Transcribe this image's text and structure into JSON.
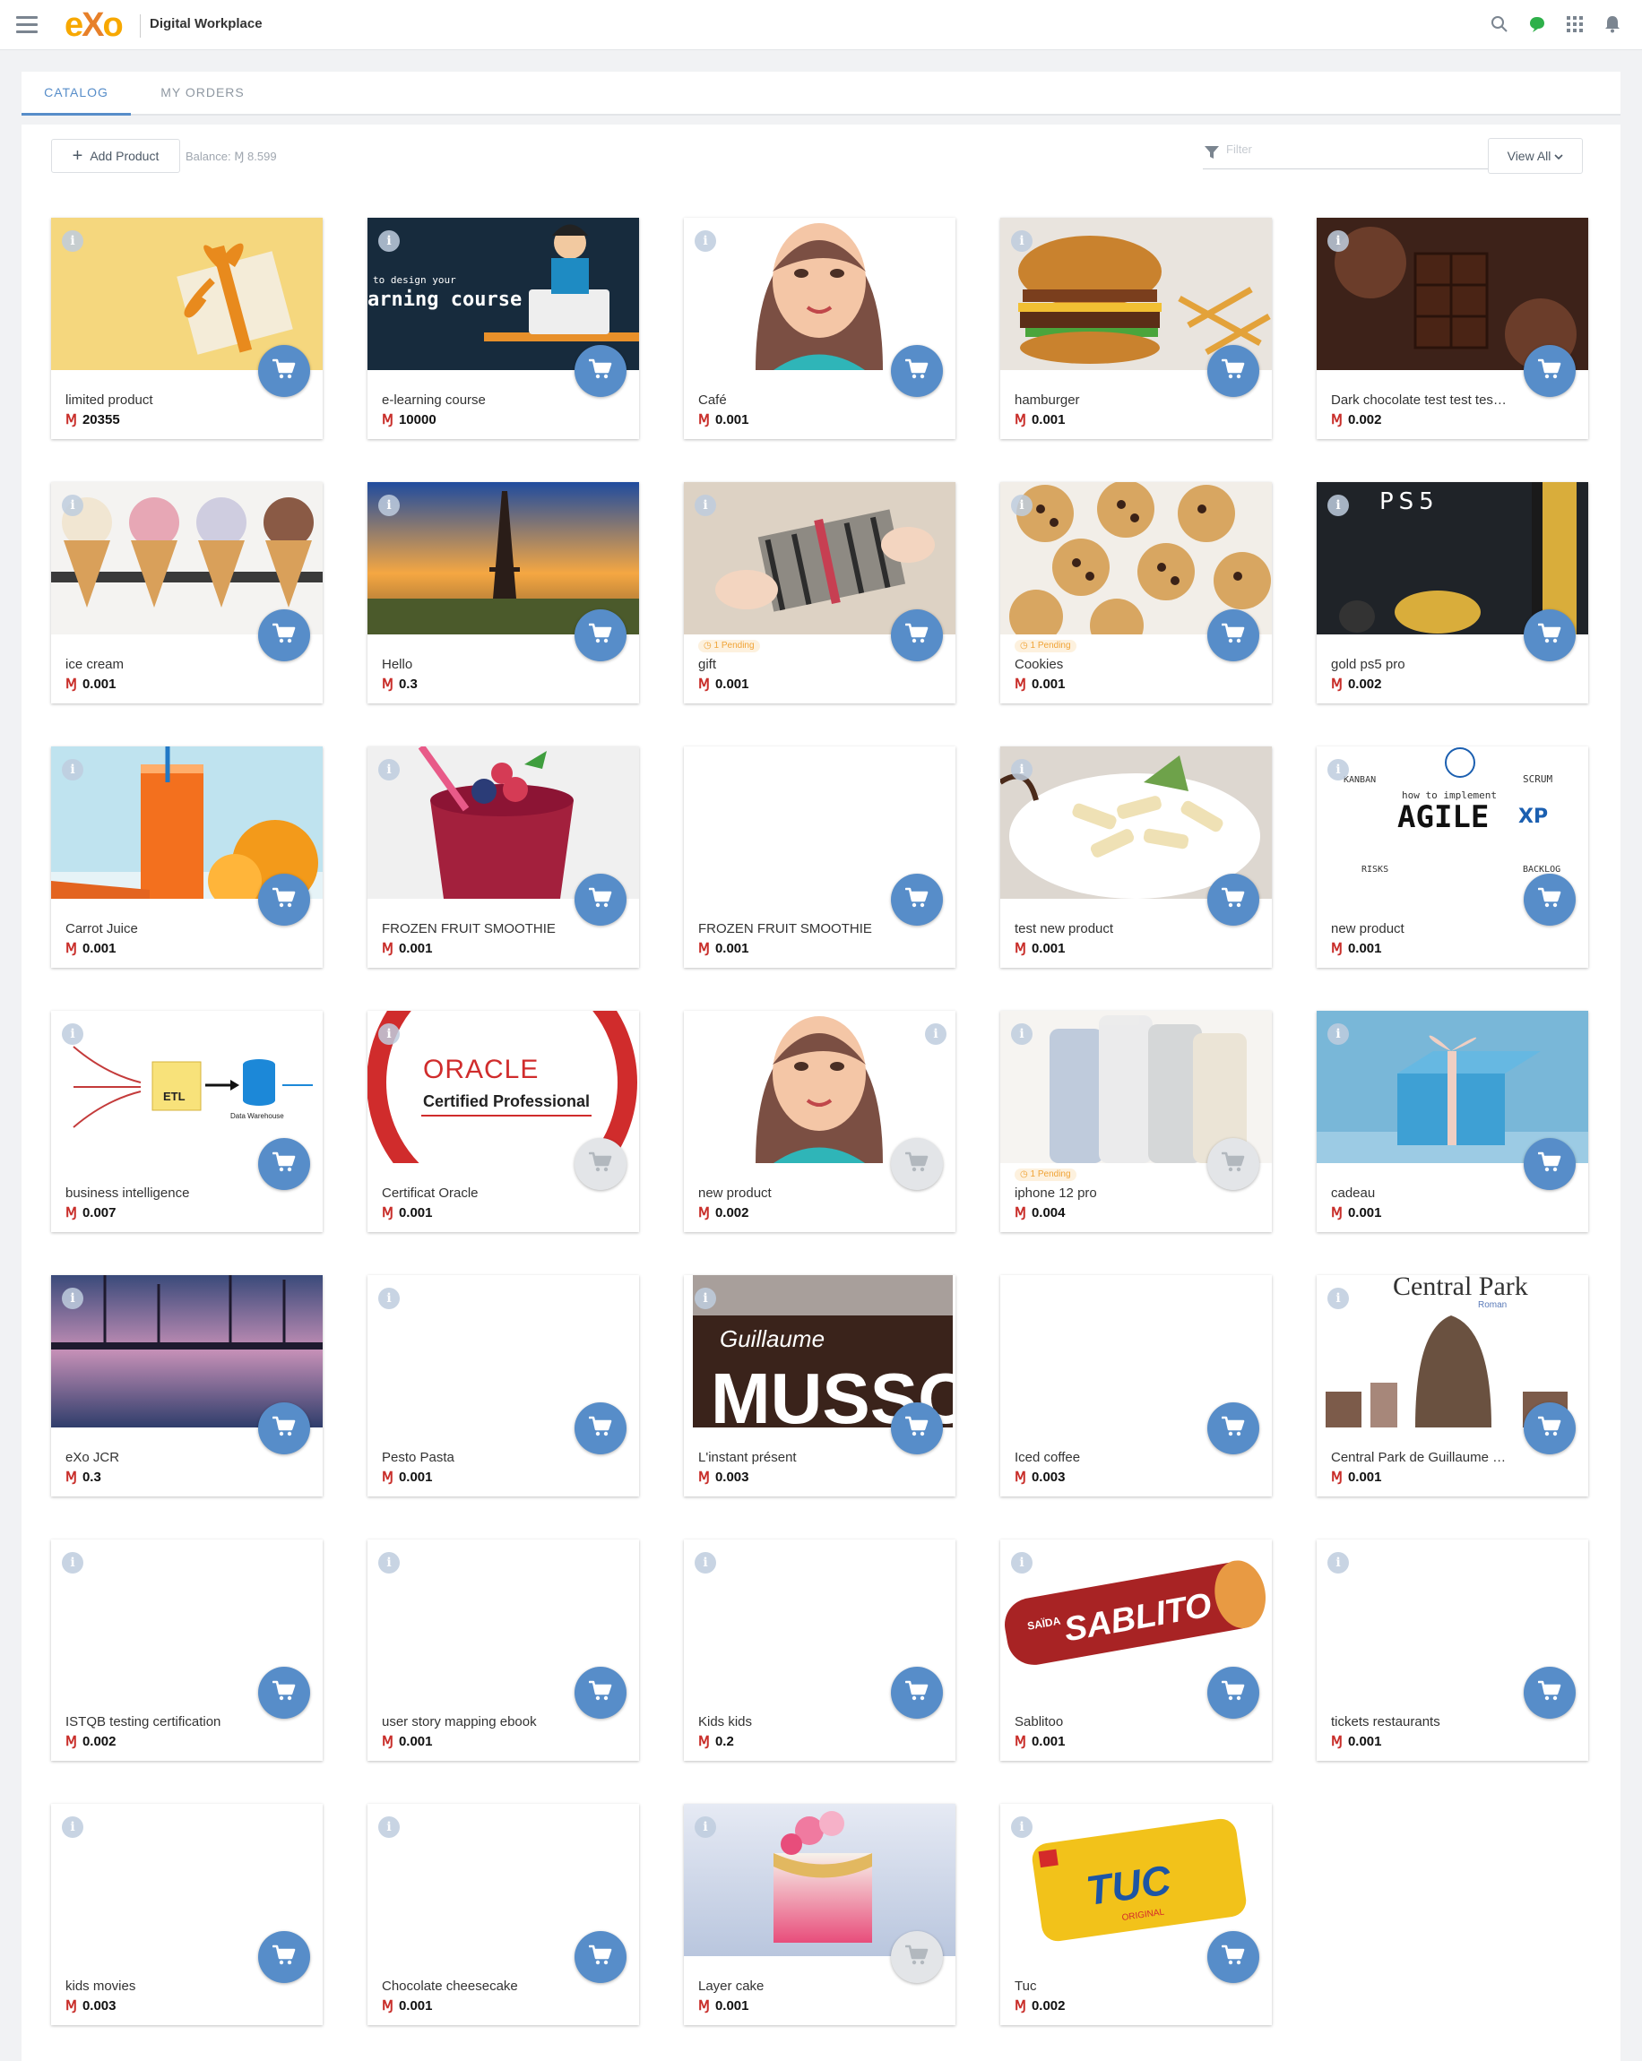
{
  "topbar": {
    "logo": "eXo",
    "title": "Digital Workplace"
  },
  "tabs": [
    {
      "label": "CATALOG"
    },
    {
      "label": "MY ORDERS"
    }
  ],
  "toolbar": {
    "add_label": "Add Product",
    "balance": "Balance: Ɱ 8.599",
    "filter_placeholder": "Filter",
    "view_label": "View All"
  },
  "currency_symbol": "Ɱ",
  "products": [
    {
      "title": "limited product",
      "price": "20355",
      "image": "gift",
      "cart_enabled": true
    },
    {
      "title": "e-learning course",
      "price": "10000",
      "image": "elearning",
      "cart_enabled": true
    },
    {
      "title": "Café",
      "price": "0.001",
      "image": "avatar",
      "cart_enabled": true
    },
    {
      "title": "hamburger",
      "price": "0.001",
      "image": "burger",
      "cart_enabled": true
    },
    {
      "title": "Dark chocolate test test test test",
      "price": "0.002",
      "image": "chocolate",
      "cart_enabled": true
    },
    {
      "title": "ice cream",
      "price": "0.001",
      "image": "icecream",
      "cart_enabled": true
    },
    {
      "title": "Hello",
      "price": "0.3",
      "image": "paris",
      "cart_enabled": true
    },
    {
      "title": "gift",
      "price": "0.001",
      "image": "giftbox",
      "cart_enabled": true,
      "pending": "1 Pending"
    },
    {
      "title": "Cookies",
      "price": "0.001",
      "image": "cookies",
      "cart_enabled": true,
      "pending": "1 Pending"
    },
    {
      "title": "gold ps5 pro",
      "price": "0.002",
      "image": "ps5",
      "cart_enabled": true
    },
    {
      "title": "Carrot Juice",
      "price": "0.001",
      "image": "juice",
      "cart_enabled": true
    },
    {
      "title": "FROZEN FRUIT SMOOTHIE",
      "price": "0.001",
      "image": "smoothie",
      "cart_enabled": true
    },
    {
      "title": "FROZEN FRUIT SMOOTHIE",
      "price": "0.001",
      "image": "blank",
      "cart_enabled": true,
      "no_info": true
    },
    {
      "title": "test new product",
      "price": "0.001",
      "image": "pasta",
      "cart_enabled": true
    },
    {
      "title": "new product",
      "price": "0.001",
      "image": "agile",
      "cart_enabled": true
    },
    {
      "title": "business intelligence",
      "price": "0.007",
      "image": "etl",
      "cart_enabled": true
    },
    {
      "title": "Certificat Oracle",
      "price": "0.001",
      "image": "oracle",
      "cart_enabled": false
    },
    {
      "title": "new product",
      "price": "0.002",
      "image": "avatar",
      "cart_enabled": false,
      "info_right": true
    },
    {
      "title": "iphone 12 pro",
      "price": "0.004",
      "image": "iphone",
      "cart_enabled": false,
      "pending": "1 Pending"
    },
    {
      "title": "cadeau",
      "price": "0.001",
      "image": "bluegift",
      "cart_enabled": true
    },
    {
      "title": "eXo JCR",
      "price": "0.3",
      "image": "lake",
      "cart_enabled": true
    },
    {
      "title": "Pesto Pasta",
      "price": "0.001",
      "image": "blank",
      "cart_enabled": true
    },
    {
      "title": "L'instant présent",
      "price": "0.003",
      "image": "musso",
      "cart_enabled": true
    },
    {
      "title": "Iced coffee",
      "price": "0.003",
      "image": "blank",
      "cart_enabled": true,
      "no_info": true
    },
    {
      "title": "Central Park de Guillaume Musso",
      "price": "0.001",
      "image": "centralpark",
      "cart_enabled": true
    },
    {
      "title": "ISTQB testing certification",
      "price": "0.002",
      "image": "blank",
      "cart_enabled": true
    },
    {
      "title": "user story mapping ebook",
      "price": "0.001",
      "image": "blank",
      "cart_enabled": true
    },
    {
      "title": "Kids kids",
      "price": "0.2",
      "image": "blank",
      "cart_enabled": true
    },
    {
      "title": "Sablitoo",
      "price": "0.001",
      "image": "sablito",
      "cart_enabled": true
    },
    {
      "title": "tickets restaurants",
      "price": "0.001",
      "image": "blank",
      "cart_enabled": true
    },
    {
      "title": "kids movies",
      "price": "0.003",
      "image": "blank",
      "cart_enabled": true
    },
    {
      "title": "Chocolate cheesecake",
      "price": "0.001",
      "image": "blank",
      "cart_enabled": true
    },
    {
      "title": "Layer cake",
      "price": "0.001",
      "image": "cake",
      "cart_enabled": false
    },
    {
      "title": "Tuc",
      "price": "0.002",
      "image": "tuc",
      "cart_enabled": true
    }
  ]
}
